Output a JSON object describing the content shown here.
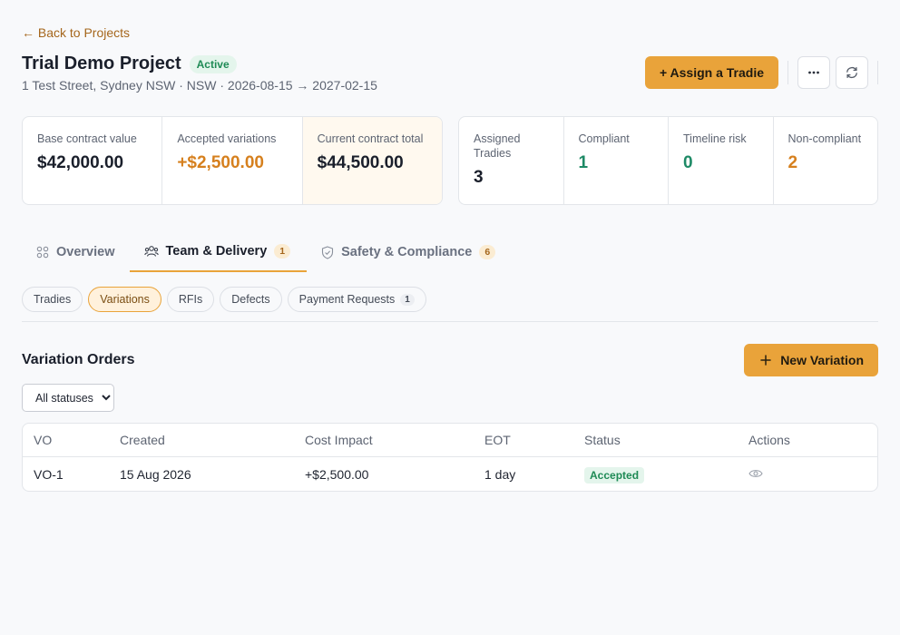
{
  "nav": {
    "back_label": "← Back to Projects"
  },
  "project": {
    "title": "Trial Demo Project",
    "status": "Active",
    "subtitle": "1 Test Street, Sydney NSW · NSW · 2026-08-15 → 2027-02-15"
  },
  "actions": {
    "assign_label": "+ Assign a Tradie",
    "more_icon": "ellipsis-icon",
    "refresh_icon": "refresh-icon"
  },
  "contract": [
    {
      "label": "Base contract value",
      "value": "$42,000.00"
    },
    {
      "label": "Accepted variations",
      "value": "+$2,500.00"
    },
    {
      "label": "Current contract total",
      "value": "$44,500.00"
    }
  ],
  "team_stats": [
    {
      "label": "Assigned Tradies",
      "value": "3"
    },
    {
      "label": "Compliant",
      "value": "1"
    },
    {
      "label": "Timeline risk",
      "value": "0"
    },
    {
      "label": "Non-compliant",
      "value": "2"
    }
  ],
  "tabs": [
    {
      "label": "Overview",
      "count": ""
    },
    {
      "label": "Team & Delivery",
      "count": "1"
    },
    {
      "label": "Safety & Compliance",
      "count": "6"
    }
  ],
  "subtabs": [
    {
      "label": "Tradies",
      "count": ""
    },
    {
      "label": "Variations",
      "count": ""
    },
    {
      "label": "RFIs",
      "count": ""
    },
    {
      "label": "Defects",
      "count": ""
    },
    {
      "label": "Payment Requests",
      "count": "1"
    }
  ],
  "variations": {
    "title": "Variation Orders",
    "new_label": "New Variation",
    "filter_selected": "All statuses",
    "columns": [
      "VO",
      "Created",
      "Cost Impact",
      "EOT",
      "Status",
      "Actions"
    ],
    "rows": [
      {
        "vo": "VO-1",
        "created": "15 Aug 2026",
        "cost": "+$2,500.00",
        "eot": "1 day",
        "status": "Accepted"
      }
    ]
  },
  "colors": {
    "accent": "#e9a33a",
    "active_green": "#1e8a55",
    "warning_orange": "#d6801e"
  }
}
